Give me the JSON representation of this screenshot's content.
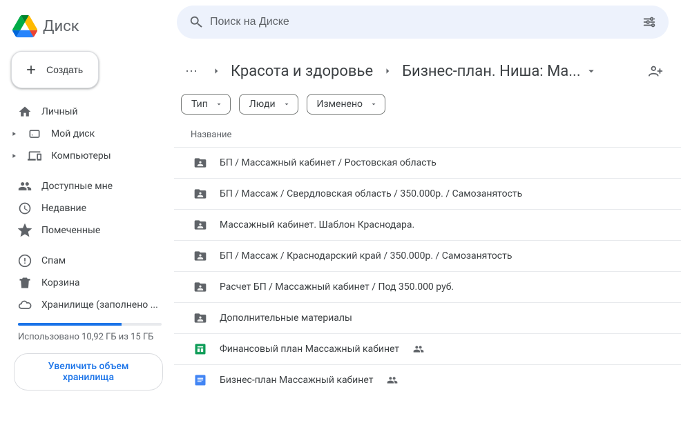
{
  "app": {
    "name": "Диск"
  },
  "create_button": {
    "label": "Создать"
  },
  "nav_primary": [
    {
      "label": "Личный",
      "icon": "home",
      "expandable": false
    },
    {
      "label": "Мой диск",
      "icon": "drive",
      "expandable": true
    },
    {
      "label": "Компьютеры",
      "icon": "devices",
      "expandable": true
    }
  ],
  "nav_secondary": [
    {
      "label": "Доступные мне",
      "icon": "shared"
    },
    {
      "label": "Недавние",
      "icon": "recent"
    },
    {
      "label": "Помеченные",
      "icon": "star"
    }
  ],
  "nav_tertiary": [
    {
      "label": "Спам",
      "icon": "spam"
    },
    {
      "label": "Корзина",
      "icon": "trash"
    },
    {
      "label": "Хранилище (заполнено ...",
      "icon": "cloud"
    }
  ],
  "storage": {
    "text": "Использовано 10,92 ГБ из 15 ГБ",
    "upgrade_label": "Увеличить объем хранилища",
    "percent": 72
  },
  "search": {
    "placeholder": "Поиск на Диске"
  },
  "breadcrumb": {
    "parent": "Красота и здоровье",
    "current": "Бизнес-план. Ниша: Ма..."
  },
  "filters": [
    {
      "label": "Тип"
    },
    {
      "label": "Люди"
    },
    {
      "label": "Изменено"
    }
  ],
  "columns": {
    "name": "Название"
  },
  "files": [
    {
      "type": "folder-shared",
      "name": "БП / Массажный кабинет / Ростовская область",
      "shared": false
    },
    {
      "type": "folder-shared",
      "name": "БП / Массаж / Свердловская область / 350.000р. / Самозанятость",
      "shared": false
    },
    {
      "type": "folder-shared",
      "name": "Массажный кабинет. Шаблон Краснодара.",
      "shared": false
    },
    {
      "type": "folder-shared",
      "name": "БП / Массаж / Краснодарский край / 350.000р. / Самозанятость",
      "shared": false
    },
    {
      "type": "folder-shared",
      "name": "Расчет БП / Массажный кабинет / Под 350.000 руб.",
      "shared": false
    },
    {
      "type": "folder-shared",
      "name": "Дополнительные материалы",
      "shared": false
    },
    {
      "type": "sheet",
      "name": "Финансовый план Массажный кабинет",
      "shared": true
    },
    {
      "type": "doc",
      "name": "Бизнес-план Массажный кабинет",
      "shared": true
    }
  ]
}
